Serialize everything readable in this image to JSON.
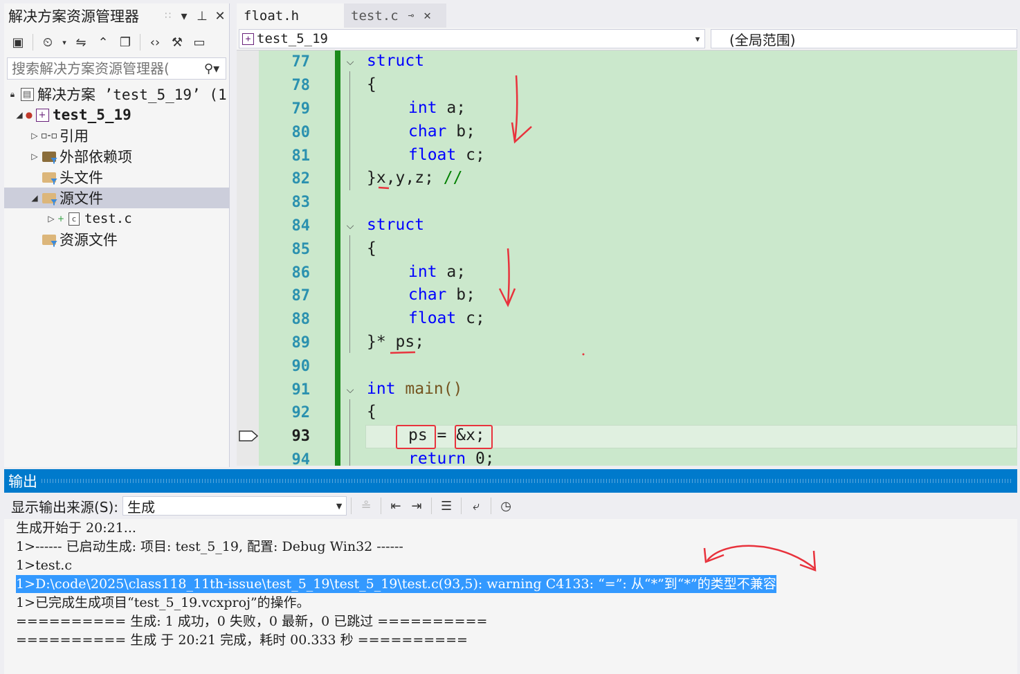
{
  "solution_explorer": {
    "title": "解决方案资源管理器",
    "search_placeholder": "搜索解决方案资源管理器(",
    "tree": {
      "solution": "解决方案 ’test_5_19’ (1 ",
      "project": "test_5_19",
      "references": "引用",
      "external_deps": "外部依赖项",
      "header_files": "头文件",
      "source_files": "源文件",
      "test_c": "test.c",
      "resource_files": "资源文件"
    }
  },
  "tabs": [
    {
      "label": "float.h"
    },
    {
      "label": "test.c"
    }
  ],
  "navbar": {
    "project": "test_5_19",
    "scope": "(全局范围)"
  },
  "editor": {
    "lines": [
      "77",
      "78",
      "79",
      "80",
      "81",
      "82",
      "83",
      "84",
      "85",
      "86",
      "87",
      "88",
      "89",
      "90",
      "91",
      "92",
      "93",
      "94"
    ],
    "code": {
      "struct1": "struct",
      "brace_open": "{",
      "int": "int",
      "a": " a;",
      "char": "char",
      "b": " b;",
      "float": "float",
      "c": " c;",
      "close1": "}x,y,z; ",
      "comment": "//",
      "struct2": "struct",
      "close2": "}* ps;",
      "int_main": "int",
      "main": " main()",
      "ps_stmt": "ps = &x;",
      "return": "return",
      "ret_val": " 0;"
    }
  },
  "output": {
    "title": "输出",
    "source_label": "显示输出来源(S):",
    "source_value": "生成",
    "lines": [
      "生成开始于 20:21...",
      "1>------ 已启动生成: 项目: test_5_19, 配置: Debug Win32 ------",
      "1>test.c",
      "1>D:\\code\\2025\\class118_11th-issue\\test_5_19\\test_5_19\\test.c(93,5): warning C4133: “=”: 从“*”到“*”的类型不兼容",
      "1>已完成生成项目“test_5_19.vcxproj”的操作。",
      "========== 生成: 1 成功，0 失败，0 最新，0 已跳过 ==========",
      "========== 生成 于 20:21 完成，耗时 00.333 秒 =========="
    ]
  },
  "colors": {
    "accent": "#007acc",
    "code_bg": "#cbe8cc",
    "keyword": "#0000ff",
    "line_number": "#2b91af",
    "annotation_red": "#e8323c"
  }
}
